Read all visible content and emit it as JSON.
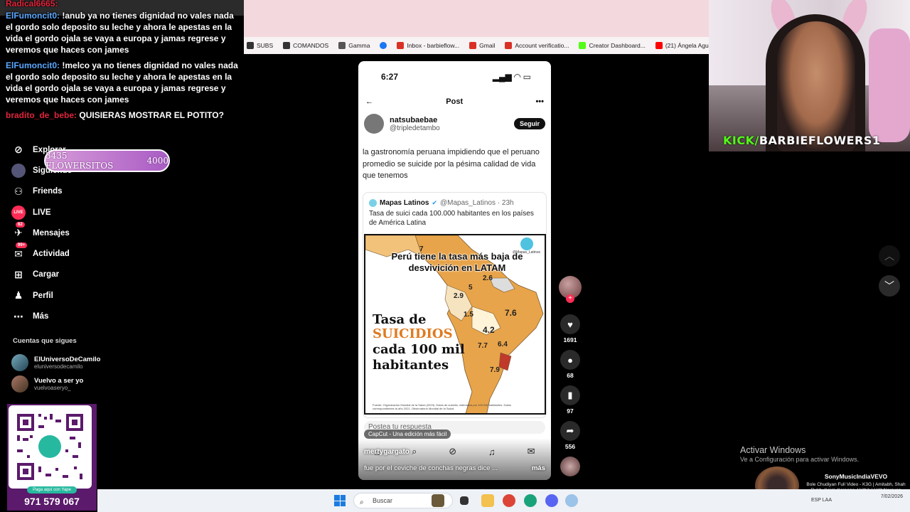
{
  "chat": {
    "messages": [
      {
        "user": "Radical6665:",
        "text": ""
      },
      {
        "user": "ElFumoncit0:",
        "text": "!anub ya no tienes dignidad no vales nada el gordo solo deposito su leche y ahora le apestas en la vida el gordo ojala se vaya a europa y jamas regrese y veremos que haces con james"
      },
      {
        "user": "ElFumoncit0:",
        "text": "!melco ya no tienes dignidad no vales nada el gordo solo deposito su leche y ahora le apestas en la vida el gordo ojala se vaya a europa y jamas regrese y veremos que haces con james"
      },
      {
        "user": "bradito_de_bebe:",
        "text": "QUISIERAS MOSTRAR EL POTITO?"
      }
    ]
  },
  "bookmarks": [
    {
      "label": "SUBS",
      "color": "#333333"
    },
    {
      "label": "COMANDOS",
      "color": "#333333"
    },
    {
      "label": "Gamma",
      "color": "#555555"
    },
    {
      "label": "",
      "color": "#1877f2"
    },
    {
      "label": "Inbox - barbieflow...",
      "color": "#d93025"
    },
    {
      "label": "Gmail",
      "color": "#d93025"
    },
    {
      "label": "Account verificatio...",
      "color": "#d93025"
    },
    {
      "label": "Creator Dashboard...",
      "color": "#53fc18"
    },
    {
      "label": "(21) Ángela Aguila...",
      "color": "#ff0000"
    }
  ],
  "flower_pill": {
    "label": "3435 FLOWERSITOS",
    "goal": "4000"
  },
  "sidebar": {
    "items": [
      {
        "label": "Explorar",
        "icon": "compass-icon",
        "glyph": "⊘"
      },
      {
        "label": "Siguiendo",
        "icon": "avatar-icon",
        "glyph": "●"
      },
      {
        "label": "Friends",
        "icon": "friends-icon",
        "glyph": "⚇"
      },
      {
        "label": "LIVE",
        "icon": "live-icon",
        "glyph": "◉"
      },
      {
        "label": "Mensajes",
        "icon": "messages-icon",
        "glyph": "✈",
        "badge": "62"
      },
      {
        "label": "Actividad",
        "icon": "activity-icon",
        "glyph": "✉",
        "badge": "99+"
      },
      {
        "label": "Cargar",
        "icon": "upload-icon",
        "glyph": "⊞"
      },
      {
        "label": "Perfil",
        "icon": "profile-icon",
        "glyph": "♟"
      },
      {
        "label": "Más",
        "icon": "more-icon",
        "glyph": "⋯"
      }
    ],
    "following_title": "Cuentas que sigues",
    "following": [
      {
        "name": "ElUniversoDeCamilo",
        "handle": "eluniversodecamilo"
      },
      {
        "name": "Vuelvo a ser yo",
        "handle": "vuelvoaseryo_"
      }
    ]
  },
  "yape": {
    "tag": "Paga aquí con Yape",
    "number": "971 579 067"
  },
  "phone": {
    "time": "6:27",
    "header_title": "Post",
    "author_name": "natsubaebae",
    "author_handle": "@tripledetambo",
    "follow_label": "Seguir",
    "post_text": "la gastronomía peruana impidiendo que el peruano promedio se suicide por la pésima calidad de vida que tenemos",
    "quote": {
      "name": "Mapas Latinos",
      "meta": "@Mapas_Latinos · 23h",
      "text": "Tasa de suici cada 100.000 habitantes en los países de América Latina",
      "overlay": "Perú tiene la tasa más baja de desvivición en LATAM",
      "big1": "Tasa de",
      "big2": "SUICIDIOS",
      "big3": "cada 100 mil habitantes",
      "logo_text": "@Mapas_Latinos",
      "source": "Fuente: Organización Mundial de la Salud (2023). Datos de suicidio, estimados por 100.000 habitantes. Datos correspondientes al año 2021. Observatorio Mundial de la Salud.",
      "values": [
        "7",
        "5",
        "2.6",
        "7.6",
        "1.5",
        "4.2",
        "2.9",
        "7.7",
        "6.4",
        "7.9"
      ]
    },
    "reply_placeholder": "Postea tu respuesta",
    "capcut": "CapCut - Una edición más fácil",
    "overlay_user": "mertygargato",
    "caption": "fue por el ceviche de conchas negras dice ...",
    "caption_more": "más"
  },
  "rail": {
    "likes": "1691",
    "comments": "68",
    "saves": "97",
    "shares": "556"
  },
  "webcam": {
    "channel_prefix": "KICK/",
    "channel_name": "BARBIEFLOWERS1"
  },
  "activate": {
    "title": "Activar Windows",
    "sub": "Ve a Configuración para activar Windows."
  },
  "music": {
    "title": "SonyMusicIndiaVEVO",
    "sub": "Bole Chudiyan Full Video - K3G | Amitabh, Shah Rukh, Kajol, Kareena, Hrithik | Udit Narayan"
  },
  "taskbar": {
    "search_placeholder": "Buscar",
    "lang": "ESP LAA",
    "date": "7/02/2026"
  }
}
